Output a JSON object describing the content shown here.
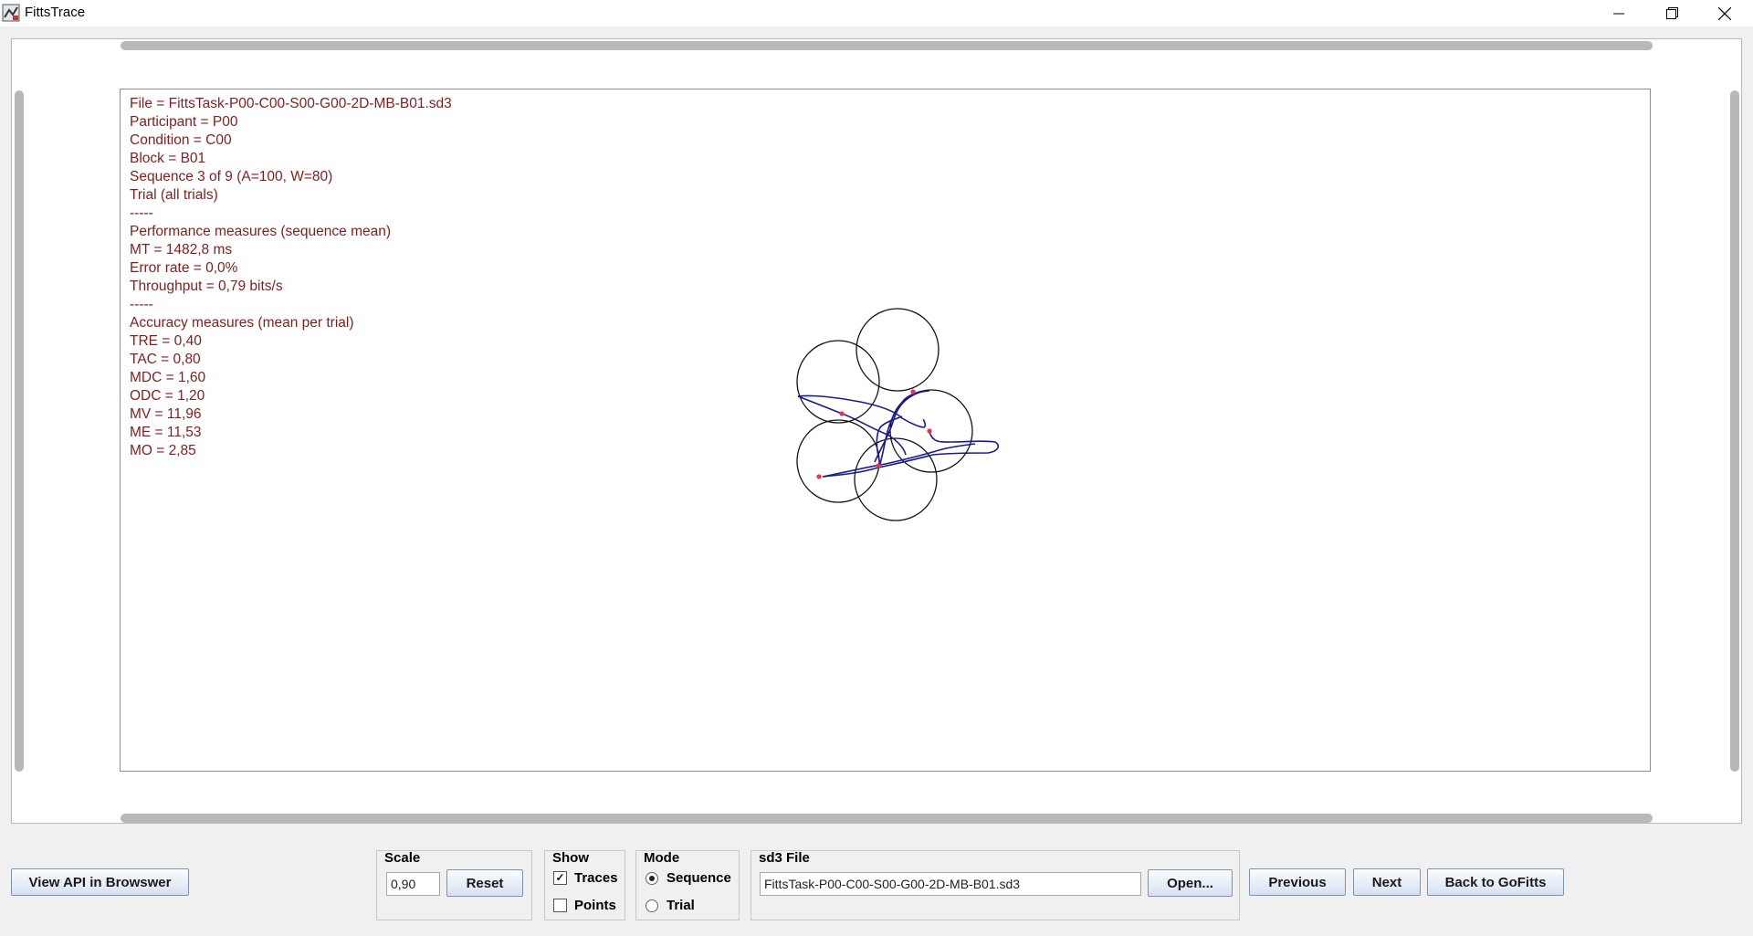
{
  "window": {
    "title": "FittsTrace",
    "icons": {
      "app": "chart-app-icon",
      "minimize": "minimize-icon",
      "restore": "restore-icon",
      "close": "close-icon"
    }
  },
  "info_lines": [
    "File = FittsTask-P00-C00-S00-G00-2D-MB-B01.sd3",
    "Participant = P00",
    "Condition = C00",
    "Block = B01",
    "Sequence 3 of 9 (A=100, W=80)",
    "Trial (all trials)",
    "-----",
    "Performance measures (sequence mean)",
    "MT = 1482,8 ms",
    "Error rate = 0,0%",
    "Throughput = 0,79 bits/s",
    "-----",
    "Accuracy measures (mean per trial)",
    "TRE = 0,40",
    "TAC = 0,80",
    "MDC = 1,60",
    "ODC = 1,20",
    "MV = 11,96",
    "ME = 11,53",
    "MO = 2,85"
  ],
  "controls": {
    "view_api_button": "View API in Browswer",
    "scale": {
      "label": "Scale",
      "value": "0,90",
      "reset_button": "Reset"
    },
    "show": {
      "label": "Show",
      "traces_label": "Traces",
      "traces_checked": true,
      "points_label": "Points",
      "points_checked": false
    },
    "mode": {
      "label": "Mode",
      "sequence_label": "Sequence",
      "trial_label": "Trial",
      "selected": "Sequence"
    },
    "sd3": {
      "label": "sd3 File",
      "file_value": "FittsTask-P00-C00-S00-G00-2D-MB-B01.sd3",
      "open_button": "Open..."
    },
    "previous_button": "Previous",
    "next_button": "Next",
    "back_button": "Back to GoFitts"
  },
  "colors": {
    "info_text": "#7f1f1f",
    "trace": "#1a1a8c",
    "endpoint": "#e8334f",
    "circle": "#111111"
  }
}
